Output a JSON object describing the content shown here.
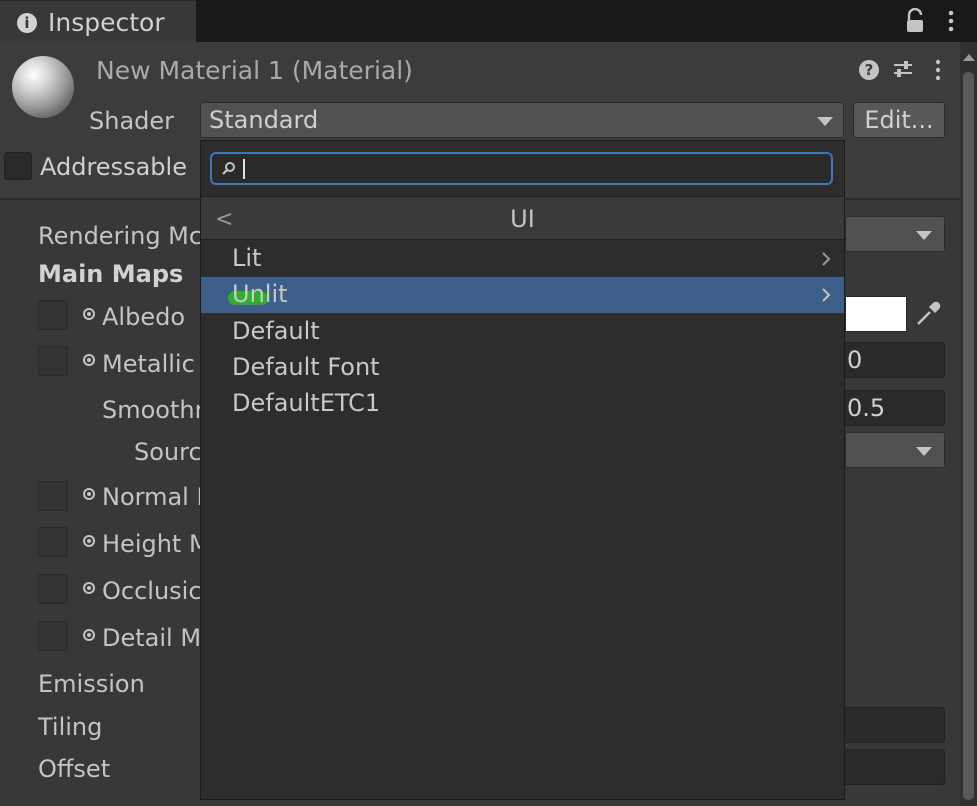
{
  "tab": {
    "title": "Inspector",
    "info_icon": "info-icon",
    "lock_icon": "lock-icon",
    "menu_icon": "kebab-menu-icon"
  },
  "header": {
    "material_title": "New Material 1 (Material)",
    "shader_label": "Shader",
    "shader_value": "Standard",
    "edit_label": "Edit...",
    "addressable_label": "Addressable",
    "addressable_checked": false
  },
  "properties": {
    "rendering_mode": "Rendering Mc",
    "main_maps": "Main Maps",
    "albedo": "Albedo",
    "metallic": "Metallic",
    "metallic_value": "0",
    "smoothness": "Smoothr",
    "smoothness_value": "0.5",
    "source": "Sourc",
    "normal": "Normal I",
    "height": "Height M",
    "occlusion": "Occlusic",
    "detail": "Detail M",
    "emission": "Emission",
    "tiling": "Tiling",
    "offset": "Offset"
  },
  "popup": {
    "search_value": "",
    "title": "UI",
    "back_icon": "<",
    "items": [
      {
        "label": "Lit",
        "submenu": true
      },
      {
        "label": "Unlit",
        "submenu": true,
        "highlighted": true
      },
      {
        "label": "Default",
        "submenu": false
      },
      {
        "label": "Default Font",
        "submenu": false
      },
      {
        "label": "DefaultETC1",
        "submenu": false
      }
    ]
  },
  "colors": {
    "panel_bg": "#383838",
    "popup_bg": "#2d2d2d",
    "highlight": "#3e5f8a",
    "search_focus": "#3a79bb",
    "albedo_color": "#ffffff"
  }
}
